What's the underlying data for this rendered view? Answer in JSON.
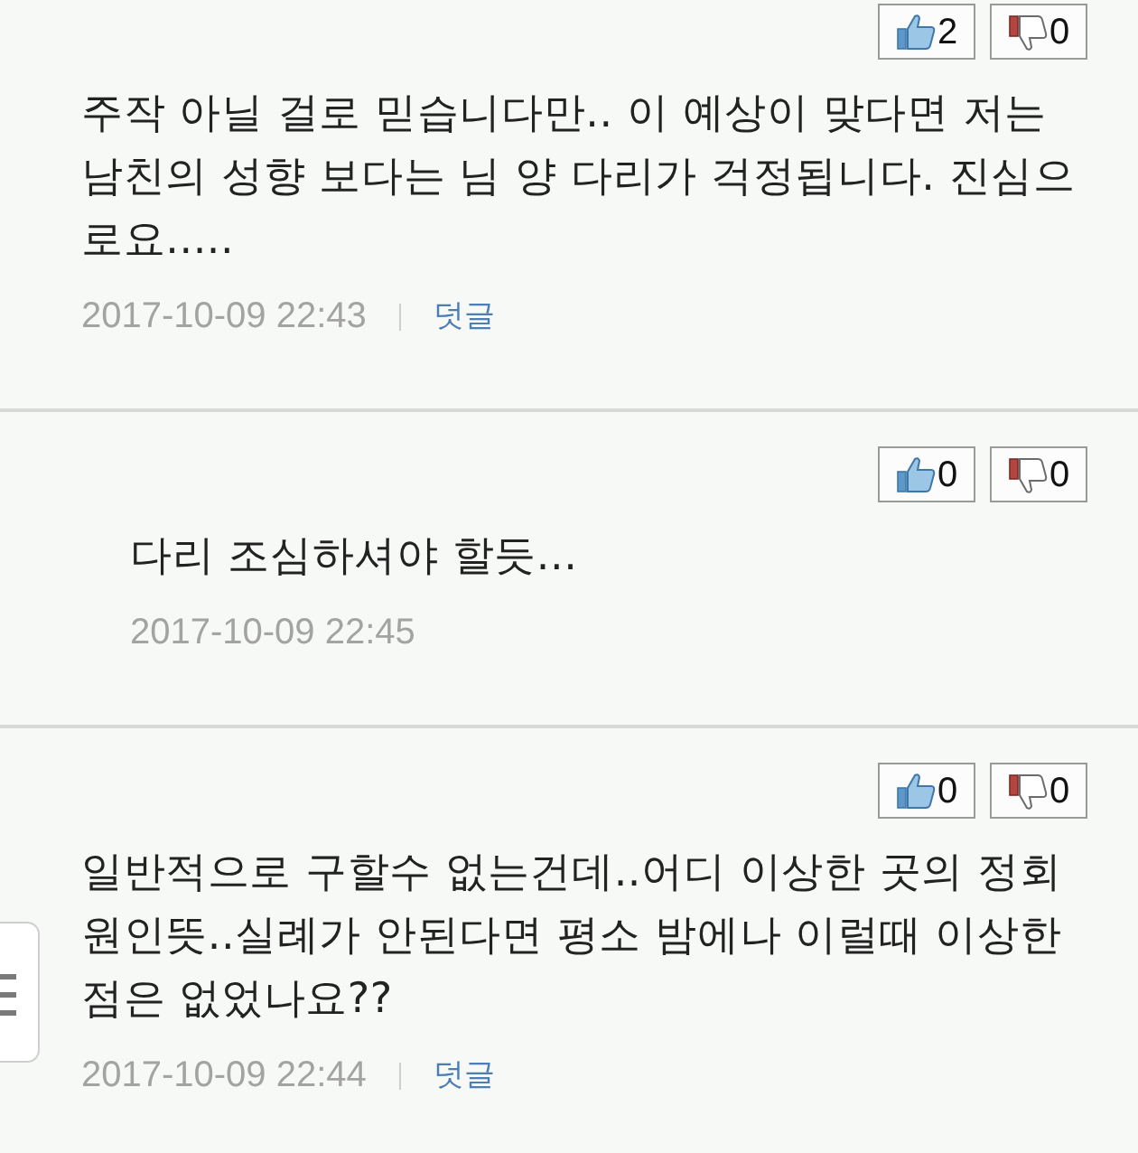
{
  "comments": [
    {
      "kind": "comment",
      "likes": "2",
      "dislikes": "0",
      "text": "주작 아닐 걸로 믿습니다만.. 이 예상이 맞다면 저는 남친의 성향 보다는 님 양 다리가 걱정됩니다. 진심으로요.....",
      "date": "2017-10-09 22:43",
      "reply_link": "덧글"
    },
    {
      "kind": "reply",
      "likes": "0",
      "dislikes": "0",
      "text": "다리 조심하셔야 할듯...",
      "date": "2017-10-09 22:45"
    },
    {
      "kind": "comment",
      "likes": "0",
      "dislikes": "0",
      "text": "일반적으로 구할수 없는건데..어디 이상한 곳의 정회원인뜻..실례가 안된다면 평소 밤에나 이럴때 이상한 점은 없었나요??",
      "date": "2017-10-09 22:44",
      "reply_link": "덧글"
    }
  ]
}
